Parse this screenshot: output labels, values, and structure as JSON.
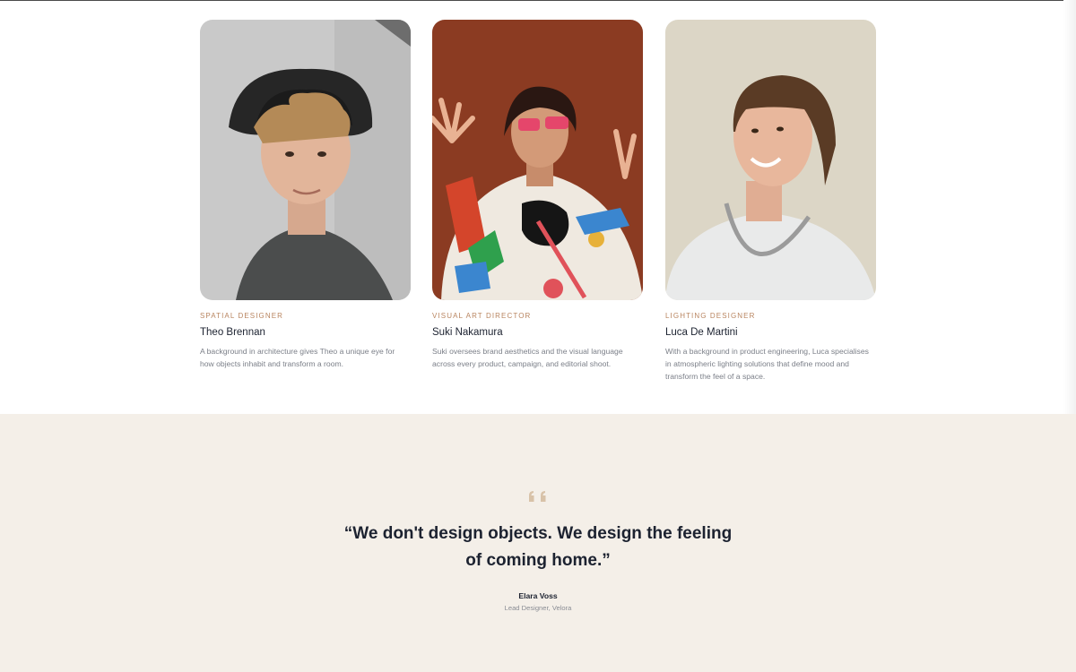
{
  "team": [
    {
      "role": "SPATIAL DESIGNER",
      "name": "Theo Brennan",
      "bio": "A background in architecture gives Theo a unique eye for how objects inhabit and transform a room."
    },
    {
      "role": "VISUAL ART DIRECTOR",
      "name": "Suki Nakamura",
      "bio": "Suki oversees brand aesthetics and the visual language across every product, campaign, and editorial shoot."
    },
    {
      "role": "LIGHTING DESIGNER",
      "name": "Luca De Martini",
      "bio": "With a background in product engineering, Luca specialises in atmospheric lighting solutions that define mood and transform the feel of a space."
    }
  ],
  "testimonial": {
    "quote": "“We don't design objects. We design the feeling of coming home.”",
    "author": "Elara Voss",
    "author_role": "Lead Designer, Velora"
  },
  "colors": {
    "accent": "#b98560",
    "quote_bg": "#f4efe8",
    "text_dark": "#1c2230",
    "text_muted": "#7b7f88"
  }
}
